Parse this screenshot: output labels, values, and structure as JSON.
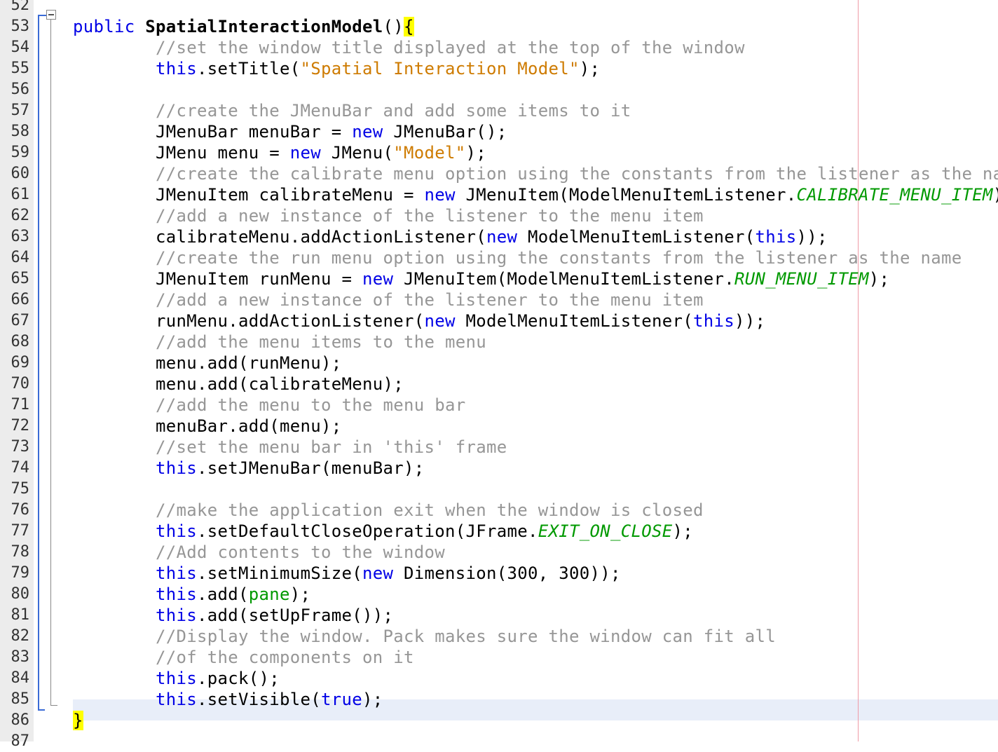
{
  "editor": {
    "line_numbers": [
      "52",
      "53",
      "54",
      "55",
      "56",
      "57",
      "58",
      "59",
      "60",
      "61",
      "62",
      "63",
      "64",
      "65",
      "66",
      "67",
      "68",
      "69",
      "70",
      "71",
      "72",
      "73",
      "74",
      "75",
      "76",
      "77",
      "78",
      "79",
      "80",
      "81",
      "82",
      "83",
      "84",
      "85",
      "86",
      "87"
    ],
    "lines": [
      [],
      [
        [
          "kw",
          "public "
        ],
        [
          "bold",
          "SpatialInteractionModel"
        ],
        [
          "",
          "()"
        ],
        [
          "br",
          "{"
        ]
      ],
      [
        [
          "",
          "    "
        ],
        [
          "cm",
          "//set the window title displayed at the top of the window"
        ]
      ],
      [
        [
          "",
          "    "
        ],
        [
          "kw",
          "this"
        ],
        [
          "",
          ".setTitle("
        ],
        [
          "str",
          "\"Spatial Interaction Model\""
        ],
        [
          "",
          ");"
        ]
      ],
      [],
      [
        [
          "",
          "    "
        ],
        [
          "cm",
          "//create the JMenuBar and add some items to it"
        ]
      ],
      [
        [
          "",
          "    JMenuBar menuBar = "
        ],
        [
          "kw",
          "new"
        ],
        [
          "",
          " JMenuBar();"
        ]
      ],
      [
        [
          "",
          "    JMenu menu = "
        ],
        [
          "kw",
          "new"
        ],
        [
          "",
          " JMenu("
        ],
        [
          "str",
          "\"Model\""
        ],
        [
          "",
          ");"
        ]
      ],
      [
        [
          "",
          "    "
        ],
        [
          "cm",
          "//create the calibrate menu option using the constants from the listener as the name"
        ]
      ],
      [
        [
          "",
          "    JMenuItem calibrateMenu = "
        ],
        [
          "kw",
          "new"
        ],
        [
          "",
          " JMenuItem(ModelMenuItemListener."
        ],
        [
          "cst",
          "CALIBRATE_MENU_ITEM"
        ],
        [
          "",
          ");"
        ]
      ],
      [
        [
          "",
          "    "
        ],
        [
          "cm",
          "//add a new instance of the listener to the menu item"
        ]
      ],
      [
        [
          "",
          "    calibrateMenu.addActionListener("
        ],
        [
          "kw",
          "new"
        ],
        [
          "",
          " ModelMenuItemListener("
        ],
        [
          "kw",
          "this"
        ],
        [
          "",
          "));"
        ]
      ],
      [
        [
          "",
          "    "
        ],
        [
          "cm",
          "//create the run menu option using the constants from the listener as the name"
        ]
      ],
      [
        [
          "",
          "    JMenuItem runMenu = "
        ],
        [
          "kw",
          "new"
        ],
        [
          "",
          " JMenuItem(ModelMenuItemListener."
        ],
        [
          "cst",
          "RUN_MENU_ITEM"
        ],
        [
          "",
          ");"
        ]
      ],
      [
        [
          "",
          "    "
        ],
        [
          "cm",
          "//add a new instance of the listener to the menu item"
        ]
      ],
      [
        [
          "",
          "    runMenu.addActionListener("
        ],
        [
          "kw",
          "new"
        ],
        [
          "",
          " ModelMenuItemListener("
        ],
        [
          "kw",
          "this"
        ],
        [
          "",
          "));"
        ]
      ],
      [
        [
          "",
          "    "
        ],
        [
          "cm",
          "//add the menu items to the menu"
        ]
      ],
      [
        [
          "",
          "    menu.add(runMenu);"
        ]
      ],
      [
        [
          "",
          "    menu.add(calibrateMenu);"
        ]
      ],
      [
        [
          "",
          "    "
        ],
        [
          "cm",
          "//add the menu to the menu bar"
        ]
      ],
      [
        [
          "",
          "    menuBar.add(menu);"
        ]
      ],
      [
        [
          "",
          "    "
        ],
        [
          "cm",
          "//set the menu bar in 'this' frame"
        ]
      ],
      [
        [
          "",
          "    "
        ],
        [
          "kw",
          "this"
        ],
        [
          "",
          ".setJMenuBar(menuBar);"
        ]
      ],
      [],
      [
        [
          "",
          "    "
        ],
        [
          "cm",
          "//make the application exit when the window is closed"
        ]
      ],
      [
        [
          "",
          "    "
        ],
        [
          "kw",
          "this"
        ],
        [
          "",
          ".setDefaultCloseOperation(JFrame."
        ],
        [
          "cst",
          "EXIT_ON_CLOSE"
        ],
        [
          "",
          ");"
        ]
      ],
      [
        [
          "",
          "    "
        ],
        [
          "cm",
          "//Add contents to the window"
        ]
      ],
      [
        [
          "",
          "    "
        ],
        [
          "kw",
          "this"
        ],
        [
          "",
          ".setMinimumSize("
        ],
        [
          "kw",
          "new"
        ],
        [
          "",
          " Dimension(300, 300));"
        ]
      ],
      [
        [
          "",
          "    "
        ],
        [
          "kw",
          "this"
        ],
        [
          "",
          ".add("
        ],
        [
          "fld",
          "pane"
        ],
        [
          "",
          ");"
        ]
      ],
      [
        [
          "",
          "    "
        ],
        [
          "kw",
          "this"
        ],
        [
          "",
          ".add(setUpFrame());"
        ]
      ],
      [
        [
          "",
          "    "
        ],
        [
          "cm",
          "//Display the window. Pack makes sure the window can fit all"
        ]
      ],
      [
        [
          "",
          "    "
        ],
        [
          "cm",
          "//of the components on it"
        ]
      ],
      [
        [
          "",
          "    "
        ],
        [
          "kw",
          "this"
        ],
        [
          "",
          ".pack();"
        ]
      ],
      [
        [
          "",
          "    "
        ],
        [
          "kw",
          "this"
        ],
        [
          "",
          ".setVisible("
        ],
        [
          "kw",
          "true"
        ],
        [
          "",
          ");"
        ]
      ],
      [
        [
          "br",
          "}"
        ]
      ],
      []
    ],
    "colors": {
      "keyword": "#0000e6",
      "string": "#ce7b00",
      "comment": "#969696",
      "constant": "#009900",
      "bracket_highlight": "#ffff00",
      "current_line": "#e8eef9",
      "margin_line": "#ef9aa6"
    },
    "current_line": "86",
    "fold_marker_line": "53"
  }
}
